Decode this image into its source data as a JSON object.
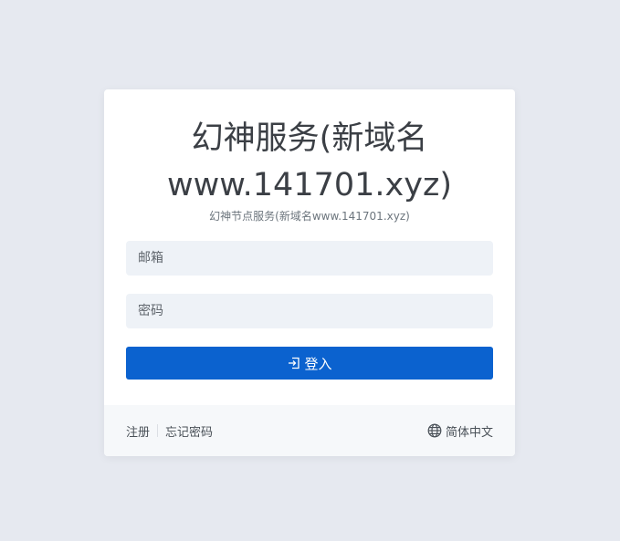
{
  "card": {
    "title": "幻神服务(新域名www.141701.xyz)",
    "subtitle": "幻神节点服务(新域名www.141701.xyz)"
  },
  "form": {
    "email_placeholder": "邮箱",
    "email_value": "",
    "password_placeholder": "密码",
    "password_value": "",
    "login_label": "登入",
    "login_icon": "login-icon"
  },
  "footer": {
    "register_label": "注册",
    "forgot_label": "忘记密码",
    "language_label": "简体中文",
    "language_icon": "globe-icon"
  },
  "colors": {
    "background": "#e6e9f0",
    "primary": "#0b62cf",
    "input_bg": "#eef2f7",
    "footer_bg": "#f6f8fa"
  }
}
